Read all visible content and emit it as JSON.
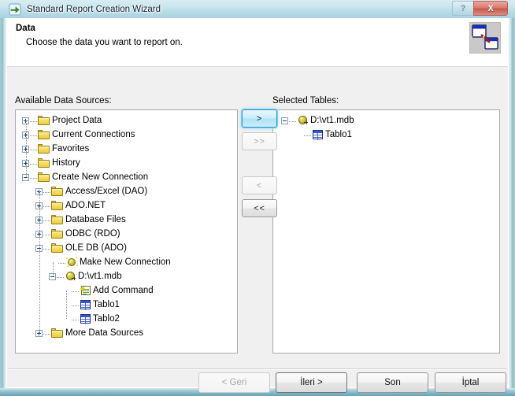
{
  "window": {
    "title": "Standard Report Creation Wizard",
    "icon": "wizard-arrow-icon",
    "help_label": "?",
    "close_label": "X",
    "frame_color": "#8ab8c4",
    "titlebar_color": "#c8e5ed"
  },
  "header": {
    "title": "Data",
    "subtitle": "Choose the data you want to report on.",
    "icon": "data-link-icon"
  },
  "panels": {
    "available_label": "Available Data Sources:",
    "selected_label": "Selected Tables:"
  },
  "available_tree": [
    {
      "label": "Project Data",
      "depth": 0,
      "icon": "folder-icon",
      "state": "collapsed"
    },
    {
      "label": "Current Connections",
      "depth": 0,
      "icon": "folder-icon",
      "state": "collapsed"
    },
    {
      "label": "Favorites",
      "depth": 0,
      "icon": "folder-icon",
      "state": "collapsed"
    },
    {
      "label": "History",
      "depth": 0,
      "icon": "folder-icon",
      "state": "collapsed"
    },
    {
      "label": "Create New Connection",
      "depth": 0,
      "icon": "folder-icon",
      "state": "expanded"
    },
    {
      "label": "Access/Excel (DAO)",
      "depth": 1,
      "icon": "folder-icon",
      "state": "collapsed"
    },
    {
      "label": "ADO.NET",
      "depth": 1,
      "icon": "folder-icon",
      "state": "collapsed"
    },
    {
      "label": "Database Files",
      "depth": 1,
      "icon": "folder-icon",
      "state": "collapsed"
    },
    {
      "label": "ODBC (RDO)",
      "depth": 1,
      "icon": "folder-icon",
      "state": "collapsed"
    },
    {
      "label": "OLE DB (ADO)",
      "depth": 1,
      "icon": "folder-icon",
      "state": "expanded"
    },
    {
      "label": "Make New Connection",
      "depth": 2,
      "icon": "new-connection-icon",
      "state": "leaf"
    },
    {
      "label": "D:\\vt1.mdb",
      "depth": 2,
      "icon": "database-icon",
      "state": "expanded"
    },
    {
      "label": "Add Command",
      "depth": 3,
      "icon": "add-command-icon",
      "state": "leaf"
    },
    {
      "label": "Tablo1",
      "depth": 3,
      "icon": "table-icon",
      "state": "leaf"
    },
    {
      "label": "Tablo2",
      "depth": 3,
      "icon": "table-icon",
      "state": "leaf"
    },
    {
      "label": "More Data Sources",
      "depth": 1,
      "icon": "folder-icon",
      "state": "collapsed"
    }
  ],
  "selected_tree": [
    {
      "label": "D:\\vt1.mdb",
      "depth": 0,
      "icon": "database-icon",
      "state": "expanded"
    },
    {
      "label": "Tablo1",
      "depth": 1,
      "icon": "table-icon",
      "state": "leaf"
    }
  ],
  "transfer_buttons": {
    "add_one": ">",
    "add_all": ">>",
    "remove_one": "<",
    "remove_all": "<<"
  },
  "footer_buttons": {
    "back": "< Geri",
    "next": "İleri >",
    "finish": "Son",
    "cancel": "İptal"
  }
}
